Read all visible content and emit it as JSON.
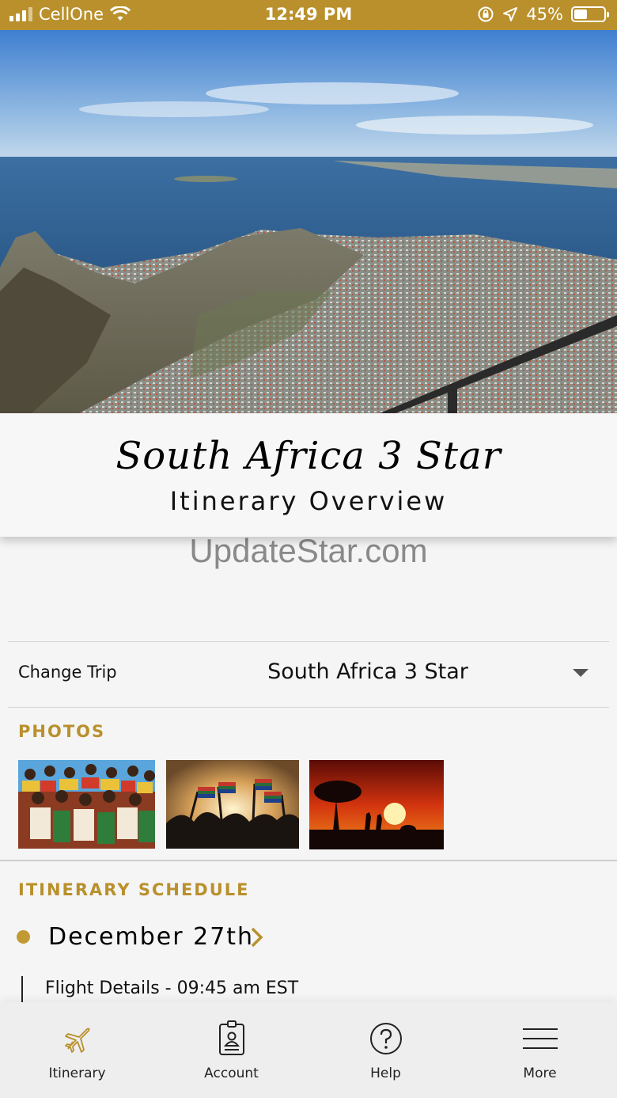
{
  "status_bar": {
    "carrier": "CellOne",
    "time": "12:49 PM",
    "battery_percent": "45%",
    "battery_level": 0.45,
    "icons": [
      "signal-icon",
      "wifi-icon",
      "orientation-lock-icon",
      "location-arrow-icon",
      "battery-icon"
    ]
  },
  "hero": {
    "title_script": "South Africa 3 Star",
    "subtitle": "Itinerary Overview"
  },
  "watermark": "UpdateStar.com",
  "change_trip": {
    "label": "Change Trip",
    "selected": "South Africa 3 Star"
  },
  "photos": {
    "heading": "PHOTOS",
    "items": [
      "photo-dancers",
      "photo-flags",
      "photo-sunset-safari"
    ]
  },
  "schedule": {
    "heading": "ITINERARY SCHEDULE",
    "day": "December 27th",
    "first_item": "Flight Details - 09:45 am EST"
  },
  "tabs": [
    {
      "label": "Itinerary",
      "icon": "airplane-icon"
    },
    {
      "label": "Account",
      "icon": "id-badge-icon"
    },
    {
      "label": "Help",
      "icon": "help-circle-icon"
    },
    {
      "label": "More",
      "icon": "menu-icon"
    }
  ],
  "colors": {
    "accent": "#b9902c",
    "dot": "#c29a33"
  }
}
